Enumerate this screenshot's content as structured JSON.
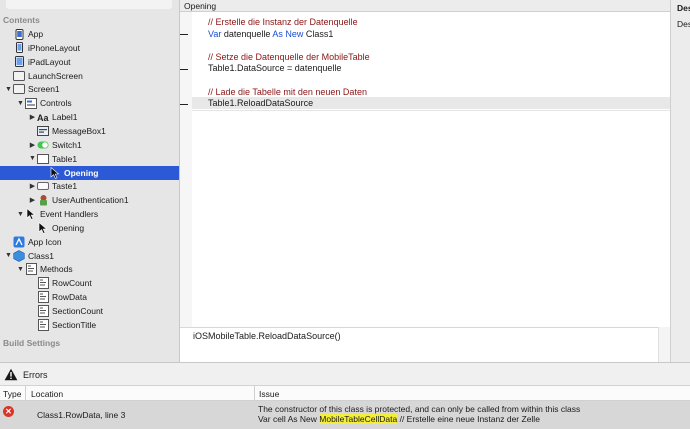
{
  "sidebar": {
    "sections": {
      "contents": "Contents",
      "build": "Build Settings"
    },
    "items": [
      {
        "label": "App",
        "icon": "app-icon",
        "depth": 0,
        "disclosure": ""
      },
      {
        "label": "iPhoneLayout",
        "icon": "phone-layout-icon",
        "depth": 0,
        "disclosure": ""
      },
      {
        "label": "iPadLayout",
        "icon": "tablet-layout-icon",
        "depth": 0,
        "disclosure": ""
      },
      {
        "label": "LaunchScreen",
        "icon": "screen-icon",
        "depth": 0,
        "disclosure": ""
      },
      {
        "label": "Screen1",
        "icon": "screen-icon",
        "depth": 0,
        "disclosure": "open"
      },
      {
        "label": "Controls",
        "icon": "controls-icon",
        "depth": 1,
        "disclosure": "open"
      },
      {
        "label": "Label1",
        "icon": "label-icon",
        "depth": 2,
        "disclosure": "closed"
      },
      {
        "label": "MessageBox1",
        "icon": "messagebox-icon",
        "depth": 2,
        "disclosure": ""
      },
      {
        "label": "Switch1",
        "icon": "switch-icon",
        "depth": 2,
        "disclosure": "closed"
      },
      {
        "label": "Table1",
        "icon": "table-icon",
        "depth": 2,
        "disclosure": "open"
      },
      {
        "label": "Opening",
        "icon": "event-cursor-icon",
        "depth": 3,
        "disclosure": "",
        "selected": true
      },
      {
        "label": "Taste1",
        "icon": "button-icon",
        "depth": 2,
        "disclosure": "closed"
      },
      {
        "label": "UserAuthentication1",
        "icon": "auth-icon",
        "depth": 2,
        "disclosure": "closed"
      },
      {
        "label": "Event Handlers",
        "icon": "event-cursor-icon",
        "depth": 1,
        "disclosure": "open"
      },
      {
        "label": "Opening",
        "icon": "event-cursor-icon",
        "depth": 2,
        "disclosure": ""
      },
      {
        "label": "App Icon",
        "icon": "app-icon-set-icon",
        "depth": 0,
        "disclosure": ""
      },
      {
        "label": "Class1",
        "icon": "class-icon",
        "depth": 0,
        "disclosure": "open"
      },
      {
        "label": "Methods",
        "icon": "methods-icon",
        "depth": 1,
        "disclosure": "open"
      },
      {
        "label": "RowCount",
        "icon": "method-icon",
        "depth": 2,
        "disclosure": ""
      },
      {
        "label": "RowData",
        "icon": "method-icon",
        "depth": 2,
        "disclosure": ""
      },
      {
        "label": "SectionCount",
        "icon": "method-icon",
        "depth": 2,
        "disclosure": ""
      },
      {
        "label": "SectionTitle",
        "icon": "method-icon",
        "depth": 2,
        "disclosure": ""
      }
    ]
  },
  "editor": {
    "tab_title": "Opening",
    "lines": [
      [
        {
          "t": "// Erstelle die Instanz der Datenquelle",
          "k": "comment"
        }
      ],
      [
        {
          "t": "Var",
          "k": "keyword"
        },
        {
          "t": " datenquelle ",
          "k": "plain"
        },
        {
          "t": "As New",
          "k": "keyword"
        },
        {
          "t": " Class1",
          "k": "plain"
        }
      ],
      [
        {
          "t": "",
          "k": "plain"
        }
      ],
      [
        {
          "t": "// Setze die Datenquelle der MobileTable",
          "k": "comment"
        }
      ],
      [
        {
          "t": "Table1.DataSource = datenquelle",
          "k": "plain"
        }
      ],
      [
        {
          "t": "",
          "k": "plain"
        }
      ],
      [
        {
          "t": "// Lade die Tabelle mit den neuen Daten",
          "k": "comment"
        }
      ],
      [
        {
          "t": "Table1.ReloadDataSource",
          "k": "plain"
        }
      ]
    ],
    "current_line": 7,
    "tip_text": "iOSMobileTable.ReloadDataSource()"
  },
  "inspector": {
    "header": "Des",
    "sub": "Des"
  },
  "errors": {
    "title": "Errors",
    "columns": {
      "type": "Type",
      "location": "Location",
      "issue": "Issue"
    },
    "rows": [
      {
        "location": "Class1.RowData, line 3",
        "issue_line1": "The constructor of this class is protected, and can only be called from within this class",
        "issue_line2_pre": "Var cell As New ",
        "issue_line2_highlight": "MobileTableCellData",
        "issue_line2_post": "  // Erstelle eine neue Instanz der Zelle"
      }
    ]
  }
}
